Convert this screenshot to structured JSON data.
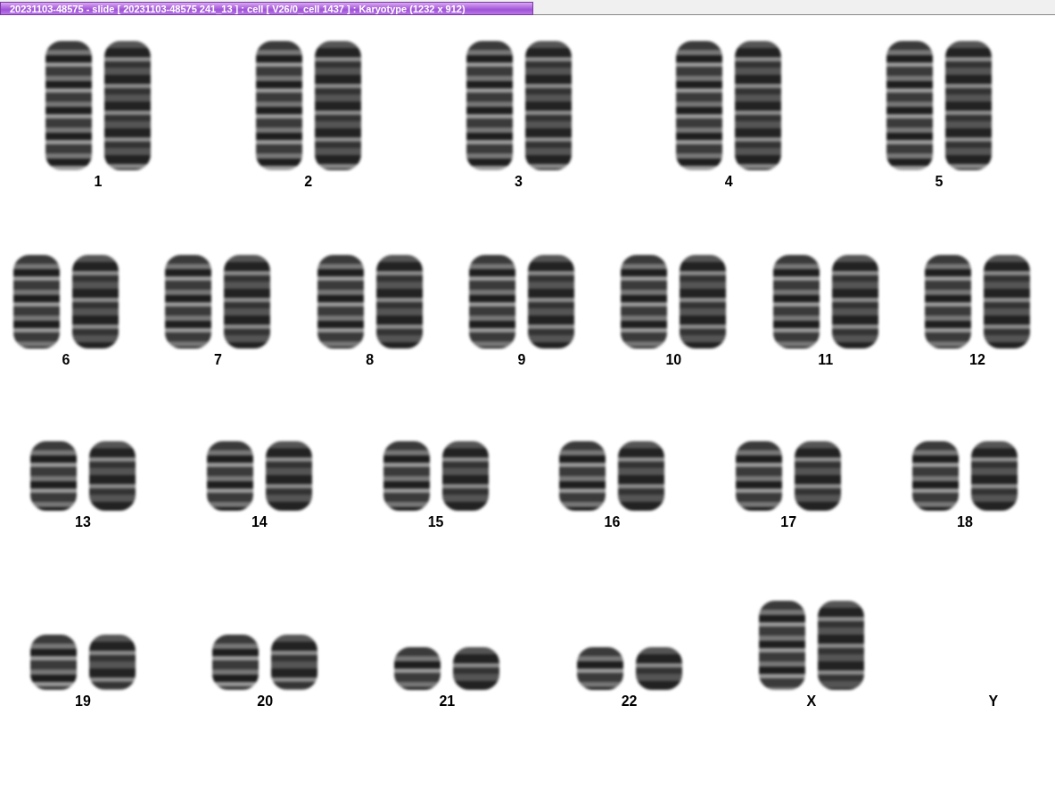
{
  "window": {
    "title": "20231103-48575 - slide [ 20231103-48575 241_13 ] : cell [ V26/0_cell 1437 ] : Karyotype  (1232 x 912)"
  },
  "rows": [
    {
      "pairs": [
        {
          "label": "1",
          "kind": "pair"
        },
        {
          "label": "2",
          "kind": "pair"
        },
        {
          "label": "3",
          "kind": "pair"
        },
        {
          "label": "4",
          "kind": "pair"
        },
        {
          "label": "5",
          "kind": "pair"
        }
      ]
    },
    {
      "pairs": [
        {
          "label": "6",
          "kind": "pair"
        },
        {
          "label": "7",
          "kind": "pair"
        },
        {
          "label": "8",
          "kind": "pair"
        },
        {
          "label": "9",
          "kind": "pair"
        },
        {
          "label": "10",
          "kind": "pair"
        },
        {
          "label": "11",
          "kind": "pair"
        },
        {
          "label": "12",
          "kind": "pair"
        }
      ]
    },
    {
      "pairs": [
        {
          "label": "13",
          "kind": "pair"
        },
        {
          "label": "14",
          "kind": "pair"
        },
        {
          "label": "15",
          "kind": "pair"
        },
        {
          "label": "16",
          "kind": "pair"
        },
        {
          "label": "17",
          "kind": "pair"
        },
        {
          "label": "18",
          "kind": "pair"
        }
      ]
    },
    {
      "pairs": [
        {
          "label": "19",
          "kind": "pair"
        },
        {
          "label": "20",
          "kind": "pair"
        },
        {
          "label": "21",
          "kind": "pair"
        },
        {
          "label": "22",
          "kind": "pair"
        },
        {
          "label": "X",
          "kind": "pair"
        },
        {
          "label": "Y",
          "kind": "empty"
        }
      ]
    }
  ]
}
